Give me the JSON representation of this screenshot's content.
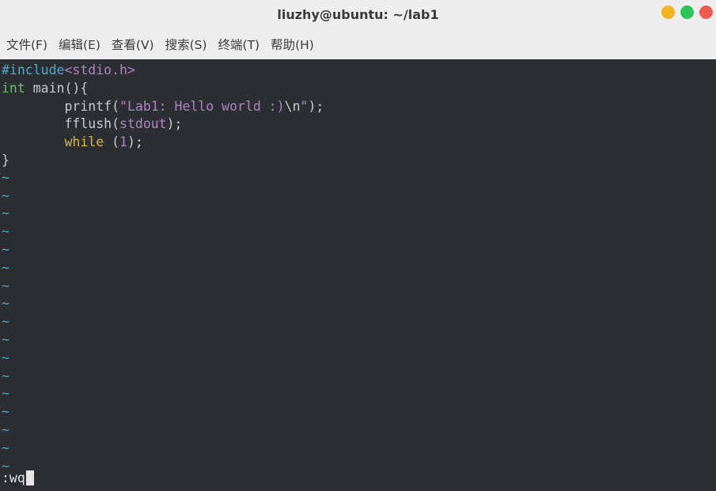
{
  "window": {
    "title": "liuzhy@ubuntu: ~/lab1",
    "controls": [
      {
        "name": "minimize",
        "color": "#f5b223"
      },
      {
        "name": "maximize",
        "color": "#2ec25a"
      },
      {
        "name": "close",
        "color": "#ec5a52"
      }
    ]
  },
  "menubar": {
    "items": [
      "文件(F)",
      "编辑(E)",
      "查看(V)",
      "搜索(S)",
      "终端(T)",
      "帮助(H)"
    ]
  },
  "editor": {
    "colors": {
      "text": "#c8ccd0",
      "preproc": "#4aa8cd",
      "type": "#6bbd6b",
      "keyword": "#d7b83a",
      "string": "#b082c4",
      "tilde": "#4aa8cd",
      "background": "#2b2f33"
    },
    "lines": [
      [
        {
          "t": "#include",
          "c": "preproc"
        },
        {
          "t": "<stdio.h>",
          "c": "string"
        }
      ],
      [
        {
          "t": "int",
          "c": "type"
        },
        {
          "t": " main(){",
          "c": "text"
        }
      ],
      [
        {
          "t": "        printf(",
          "c": "text"
        },
        {
          "t": "\"Lab1: Hello world :)",
          "c": "string"
        },
        {
          "t": "\\n",
          "c": "text"
        },
        {
          "t": "\"",
          "c": "string"
        },
        {
          "t": ");",
          "c": "text"
        }
      ],
      [
        {
          "t": "        fflush(",
          "c": "text"
        },
        {
          "t": "stdout",
          "c": "string"
        },
        {
          "t": ");",
          "c": "text"
        }
      ],
      [
        {
          "t": "        ",
          "c": "text"
        },
        {
          "t": "while",
          "c": "keyword"
        },
        {
          "t": " (",
          "c": "text"
        },
        {
          "t": "1",
          "c": "string"
        },
        {
          "t": ");",
          "c": "text"
        }
      ],
      [
        {
          "t": "}",
          "c": "text"
        }
      ]
    ],
    "tilde_char": "~",
    "tilde_count": 17,
    "command": ":wq"
  }
}
